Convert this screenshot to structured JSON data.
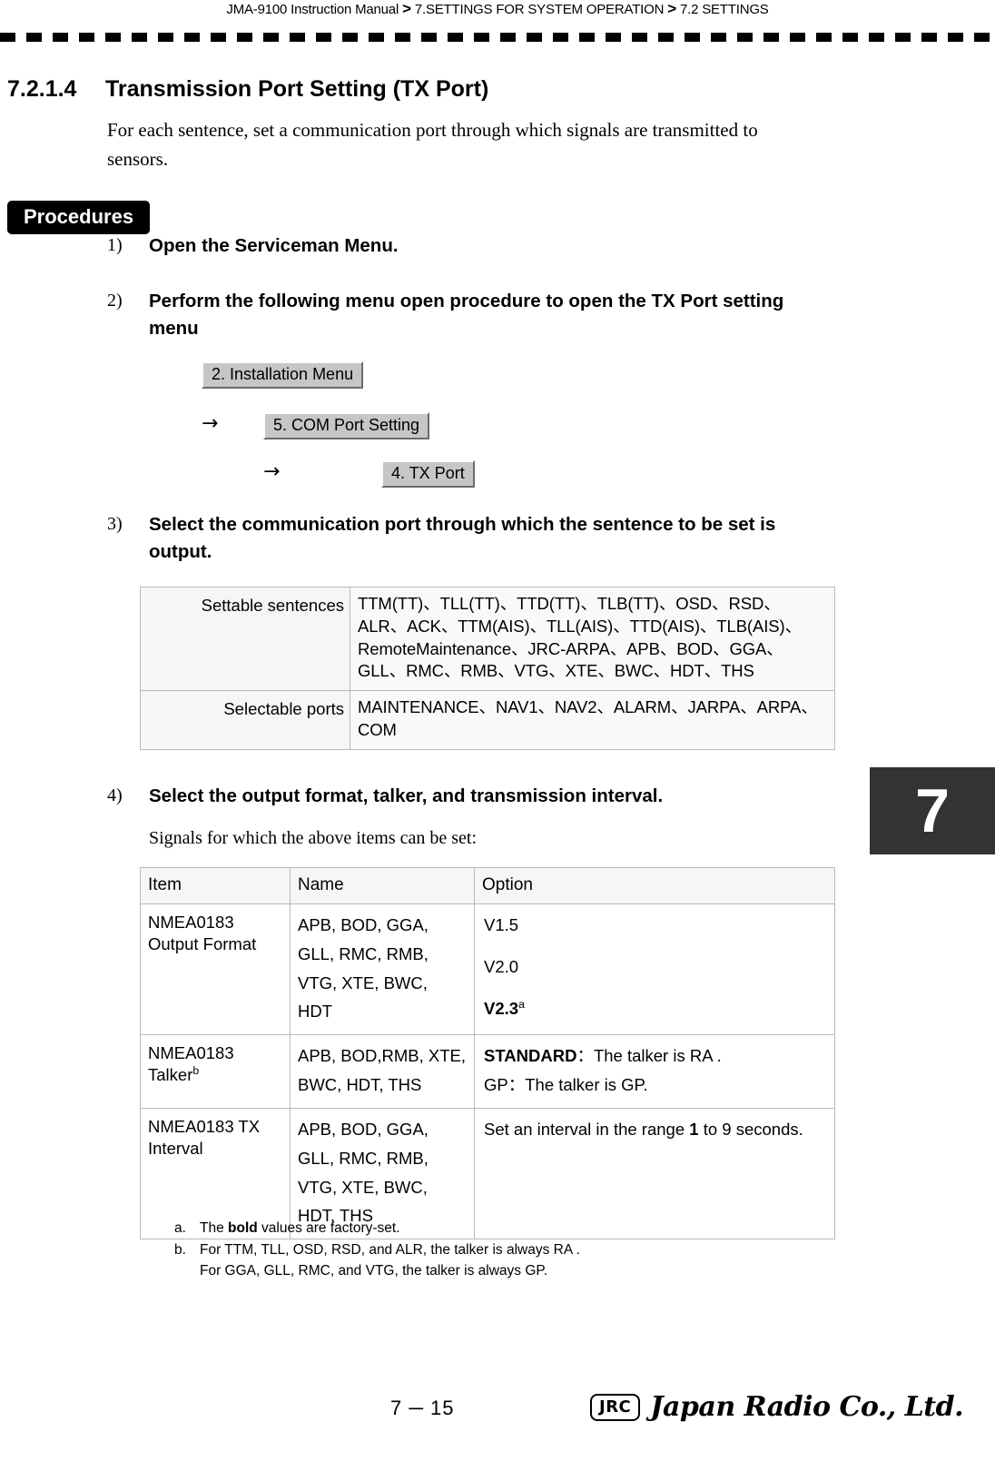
{
  "header": {
    "manual": "JMA-9100 Instruction Manual",
    "separator": ">",
    "chapter": "7.SETTINGS FOR SYSTEM OPERATION",
    "section": "7.2  SETTINGS"
  },
  "chapter_tab": "7",
  "section_heading": {
    "number": "7.2.1.4",
    "title": "Transmission Port Setting (TX Port)"
  },
  "intro": "For each sentence, set a communication port through which signals are transmitted to sensors.",
  "procedures_badge": "Procedures",
  "steps": [
    {
      "num": "1)",
      "text": "Open the Serviceman Menu."
    },
    {
      "num": "2)",
      "text": "Perform the following menu open procedure to open the TX Port setting menu"
    },
    {
      "num": "3)",
      "text": "Select the communication port through which the sentence to be set is output."
    },
    {
      "num": "4)",
      "text": "Select the output format, talker, and transmission interval."
    }
  ],
  "menu_path": {
    "button1": "2. Installation Menu",
    "arrow1": "→",
    "button2": "5. COM Port Setting",
    "arrow2": "→",
    "button3": "4. TX Port"
  },
  "sentences_table": {
    "rows": [
      {
        "label": "Settable sentences",
        "value": "TTM(TT)、TLL(TT)、TTD(TT)、TLB(TT)、OSD、RSD、ALR、ACK、TTM(AIS)、TLL(AIS)、TTD(AIS)、TLB(AIS)、RemoteMaintenance、JRC-ARPA、APB、BOD、GGA、GLL、RMC、RMB、VTG、XTE、BWC、HDT、THS"
      },
      {
        "label": "Selectable ports",
        "value": "MAINTENANCE、NAV1、NAV2、ALARM、JARPA、ARPA、COM"
      }
    ]
  },
  "signals_note": "Signals for which the above items can be set:",
  "options_table": {
    "headers": [
      "Item",
      "Name",
      "Option"
    ],
    "rows": [
      {
        "item": "NMEA0183 Output Format",
        "item_sup": "",
        "name": "APB, BOD, GGA, GLL, RMC, RMB, VTG, XTE,   BWC, HDT",
        "options": [
          {
            "text": "V1.5",
            "bold": false,
            "spaced": false
          },
          {
            "text": "V2.0",
            "bold": false,
            "spaced": true
          },
          {
            "text": "V2.3",
            "bold": true,
            "spaced": true,
            "sup": "a"
          }
        ]
      },
      {
        "item": "NMEA0183 Talker",
        "item_sup": "b",
        "name": "APB, BOD,RMB, XTE, BWC, HDT, THS",
        "options": [
          {
            "text": "STANDARD",
            "bold": true,
            "spaced": false,
            "rest": "：The talker is RA ."
          },
          {
            "text": "GP",
            "bold": false,
            "spaced": false,
            "rest": "：The talker is GP."
          }
        ]
      },
      {
        "item": "NMEA0183 TX Interval",
        "item_sup": "",
        "name": "APB, BOD, GGA, GLL, RMC, RMB, VTG, XTE, BWC, HDT, THS",
        "options": [
          {
            "text": "Set an interval in the range ",
            "bold": false,
            "spaced": false,
            "bold_part": "1",
            "rest": " to 9 seconds."
          }
        ]
      }
    ]
  },
  "footnotes": [
    {
      "mark": "a.",
      "pre": "The ",
      "bold": "bold",
      "post": " values are factory-set.",
      "cont": ""
    },
    {
      "mark": "b.",
      "pre": "For TTM, TLL, OSD, RSD, and ALR, the talker is always RA .",
      "bold": "",
      "post": "",
      "cont": "For GGA, GLL, RMC, and VTG, the talker is always GP."
    }
  ],
  "footer": {
    "page_number": "7 ─ 15",
    "logo_mark": "JRC",
    "logo_name": "Japan Radio Co., Ltd."
  }
}
